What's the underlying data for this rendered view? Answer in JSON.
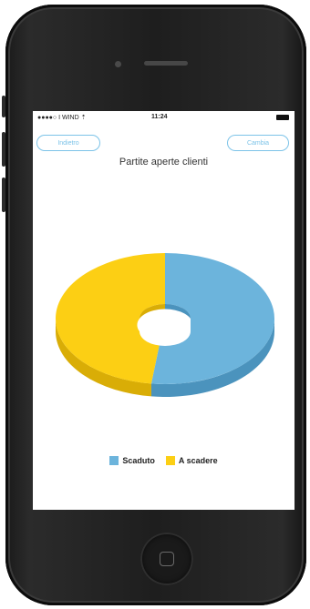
{
  "status_bar": {
    "carrier": "●●●●○ I WIND ⇡",
    "time": "11:24"
  },
  "nav": {
    "left_label": "Indietro",
    "right_label": "Cambia"
  },
  "title": "Partite aperte clienti",
  "colors": {
    "scaduto": "#6cb4dc",
    "a_scadere": "#fccf14",
    "accent": "#7cc3e8"
  },
  "icons": {
    "home": "home-button-icon",
    "battery": "battery-icon"
  },
  "chart_data": {
    "type": "pie",
    "title": "Partite aperte clienti",
    "categories": [
      "Scaduto",
      "A scadere"
    ],
    "values": [
      52,
      48
    ],
    "donut": true,
    "style": "3d",
    "legend_position": "bottom"
  },
  "legend": [
    {
      "label": "Scaduto"
    },
    {
      "label": "A scadere"
    }
  ]
}
